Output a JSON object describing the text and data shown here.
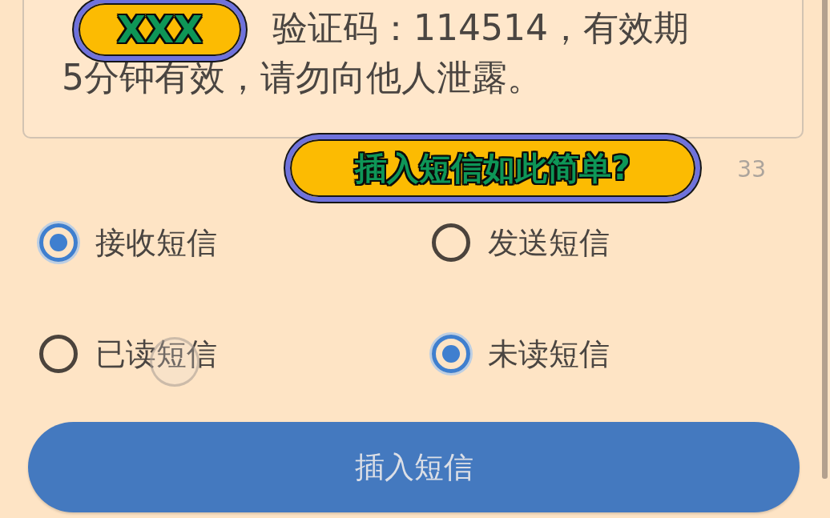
{
  "message_field": {
    "value": "验证码：114514，有效期\n5分钟有效，请勿向他人泄露。"
  },
  "character_count": "33",
  "radio_groups": [
    {
      "options": [
        {
          "label": "接收短信",
          "selected": true,
          "touched": false
        },
        {
          "label": "发送短信",
          "selected": false,
          "touched": false
        }
      ]
    },
    {
      "options": [
        {
          "label": "已读短信",
          "selected": false,
          "touched": true
        },
        {
          "label": "未读短信",
          "selected": true,
          "touched": false
        }
      ]
    }
  ],
  "insert_button": {
    "label": "插入短信"
  },
  "overlays": [
    {
      "kind": "name_cover",
      "text": "XXX"
    },
    {
      "kind": "caption",
      "text": "插入短信如此简单?"
    }
  ]
}
